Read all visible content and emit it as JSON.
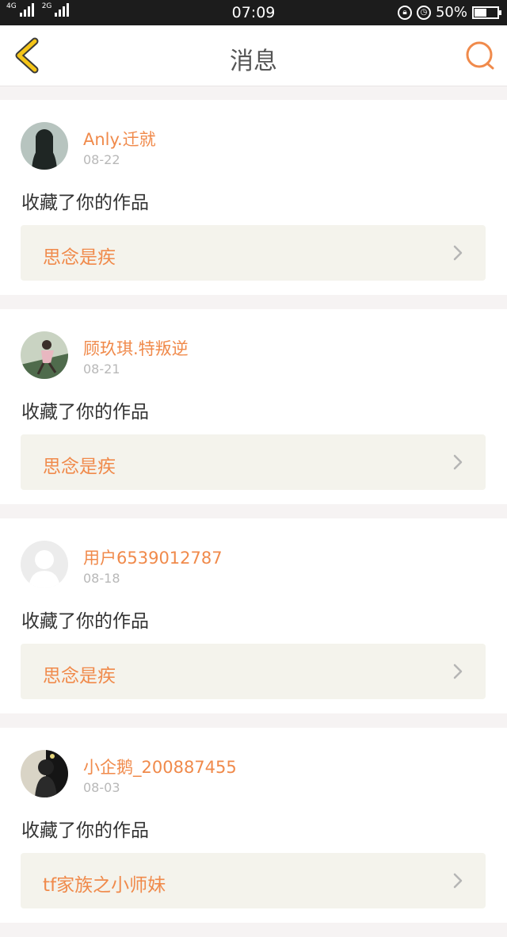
{
  "status_bar": {
    "net1": "4G",
    "net2": "2G",
    "time": "07:09",
    "battery": "50%",
    "icons": [
      "rotation-lock-icon",
      "alarm-icon",
      "battery-icon"
    ]
  },
  "header": {
    "title": "消息",
    "back_icon": "chevron-left-icon",
    "search_icon": "search-icon"
  },
  "colors": {
    "accent": "#f08a4b",
    "back_icon": "#f5c518",
    "work_bg": "#f4f3ec"
  },
  "messages": [
    {
      "username": "Anly.迁就",
      "date": "08-22",
      "action": "收藏了你的作品",
      "work_title": "思念是疾",
      "avatar": "photo-avatar"
    },
    {
      "username": "顾玖琪.特叛逆",
      "date": "08-21",
      "action": "收藏了你的作品",
      "work_title": "思念是疾",
      "avatar": "photo-avatar"
    },
    {
      "username": "用户6539012787",
      "date": "08-18",
      "action": "收藏了你的作品",
      "work_title": "思念是疾",
      "avatar": "default-avatar"
    },
    {
      "username": "小企鹅_200887455",
      "date": "08-03",
      "action": "收藏了你的作品",
      "work_title": "tf家族之小师妹",
      "avatar": "photo-avatar"
    }
  ]
}
